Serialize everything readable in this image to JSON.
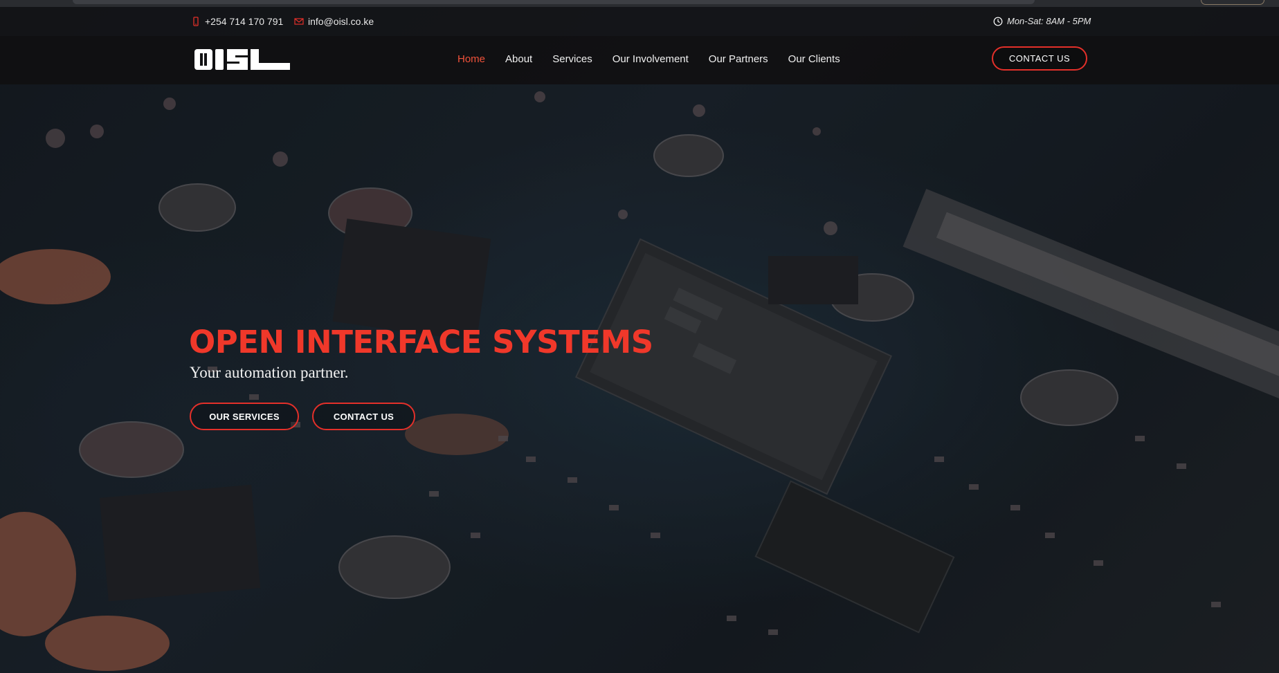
{
  "topbar": {
    "phone": "+254 714 170 791",
    "email": "info@oisl.co.ke",
    "hours": "Mon-Sat: 8AM - 5PM",
    "icons": {
      "phone": "phone-icon",
      "email": "envelope-icon",
      "hours": "clock-icon"
    }
  },
  "navbar": {
    "logo_text": "OISL",
    "links": [
      {
        "label": "Home",
        "active": true
      },
      {
        "label": "About"
      },
      {
        "label": "Services"
      },
      {
        "label": "Our Involvement"
      },
      {
        "label": "Our Partners"
      },
      {
        "label": "Our Clients"
      }
    ],
    "cta_label": "CONTACT US"
  },
  "hero": {
    "title": "OPEN INTERFACE SYSTEMS",
    "subtitle": "Your automation partner.",
    "buttons": [
      {
        "label": "OUR SERVICES"
      },
      {
        "label": "CONTACT US"
      }
    ]
  },
  "colors": {
    "accent": "#e4302a",
    "title_red": "#f0382a",
    "active_link": "#f0523a",
    "bar_bg": "#141416"
  }
}
